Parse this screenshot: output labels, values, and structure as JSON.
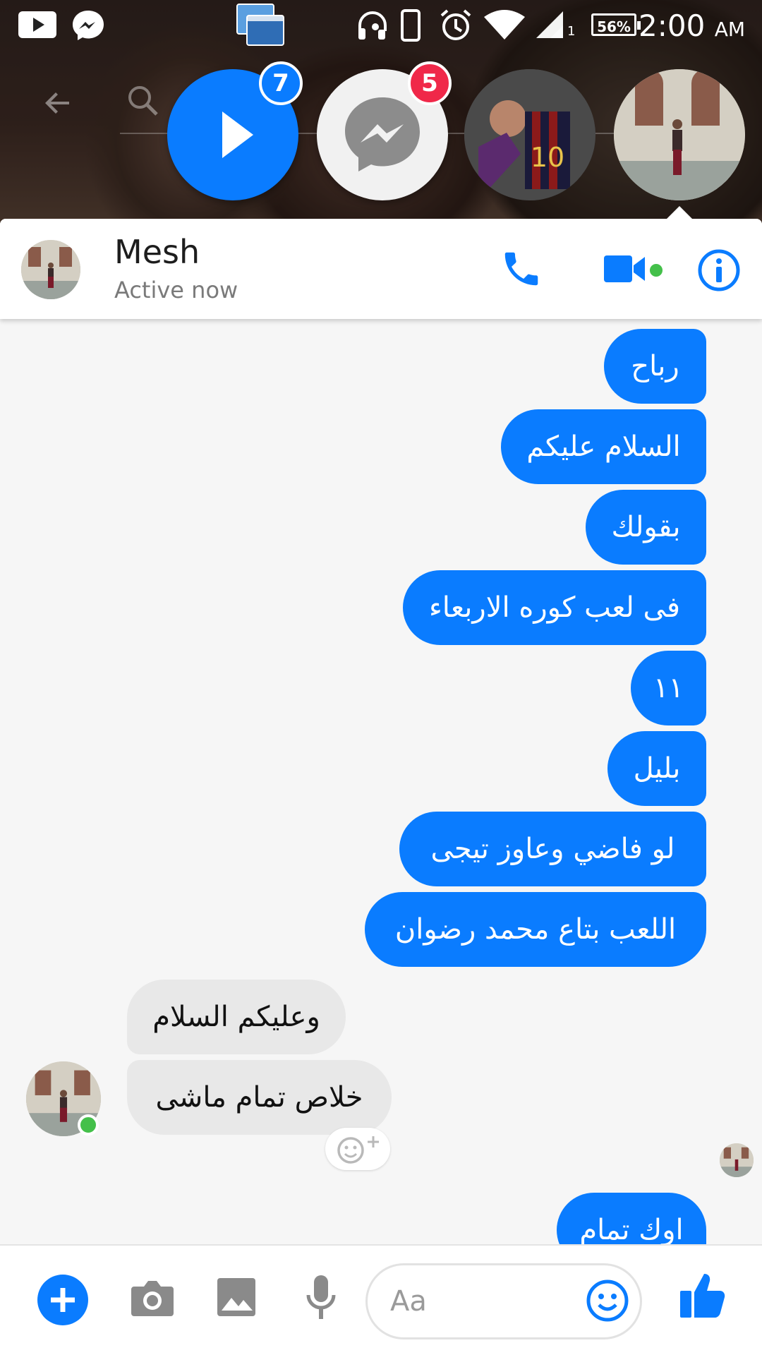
{
  "status_bar": {
    "battery": "56%",
    "time": "2:00",
    "ampm": "AM",
    "signal_sub": "1"
  },
  "chat_heads": {
    "video_badge": "7",
    "messenger_badge": "5"
  },
  "header": {
    "name": "Mesh",
    "status": "Active now"
  },
  "messages": [
    {
      "text": "رباح",
      "direction": "out"
    },
    {
      "text": "السلام عليكم",
      "direction": "out"
    },
    {
      "text": "بقولك",
      "direction": "out"
    },
    {
      "text": "فى لعب كوره الاربعاء",
      "direction": "out"
    },
    {
      "text": "١١",
      "direction": "out"
    },
    {
      "text": "بليل",
      "direction": "out"
    },
    {
      "text": "لو فاضي وعاوز تيجى",
      "direction": "out"
    },
    {
      "text": "اللعب بتاع محمد رضوان",
      "direction": "out"
    },
    {
      "text": "وعليكم السلام",
      "direction": "in"
    },
    {
      "text": "خلاص تمام ماشى",
      "direction": "in"
    },
    {
      "text": "اوك تمام",
      "direction": "out"
    }
  ],
  "composer": {
    "placeholder": "Aa"
  },
  "colors": {
    "accent": "#0a7cff",
    "incoming_bubble": "#e8e8e8",
    "online": "#44c04a",
    "badge_red": "#f02849"
  },
  "icons": [
    "youtube-icon",
    "messenger-icon",
    "recents-icon",
    "headset-icon",
    "phone-status-icon",
    "alarm-icon",
    "wifi-icon",
    "signal-icon",
    "back-icon",
    "search-icon",
    "play-icon",
    "phone-icon",
    "video-camera-icon",
    "info-icon",
    "add-reaction-icon",
    "plus-icon",
    "camera-icon",
    "gallery-icon",
    "microphone-icon",
    "emoji-icon",
    "thumbs-up-icon"
  ]
}
